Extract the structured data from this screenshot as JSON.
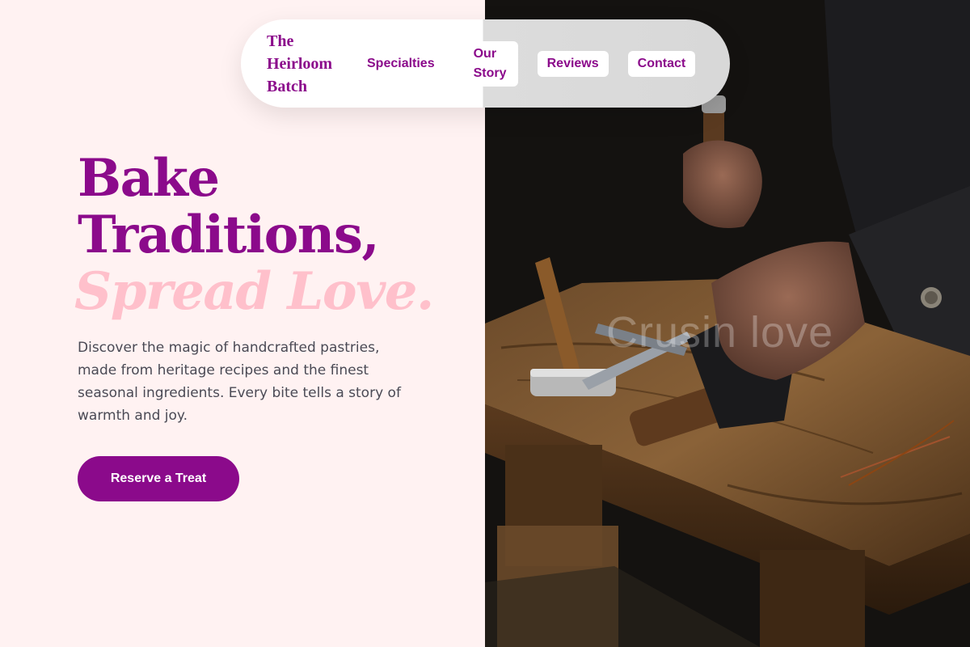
{
  "nav": {
    "brand": "The\nHeirloom\nBatch",
    "links": [
      {
        "label": "Specialties"
      },
      {
        "label": "Our\nStory"
      },
      {
        "label": "Reviews"
      },
      {
        "label": "Contact"
      }
    ]
  },
  "hero": {
    "line1": "Bake",
    "line2": "Traditions,",
    "line3": "Spread Love.",
    "description": "Discover the magic of handcrafted pastries, made from heritage recipes and the finest seasonal ingredients. Every bite tells a story of warmth and joy.",
    "cta_label": "Reserve a Treat"
  },
  "photo": {
    "watermark": "Crusin love"
  },
  "colors": {
    "brand": "#8b0a8b",
    "accent_pink": "#ffc0cb",
    "page_bg": "#fff2f2",
    "body_text": "#4a4a55"
  },
  "icons": [
    "craftsman-workbench-photo"
  ]
}
